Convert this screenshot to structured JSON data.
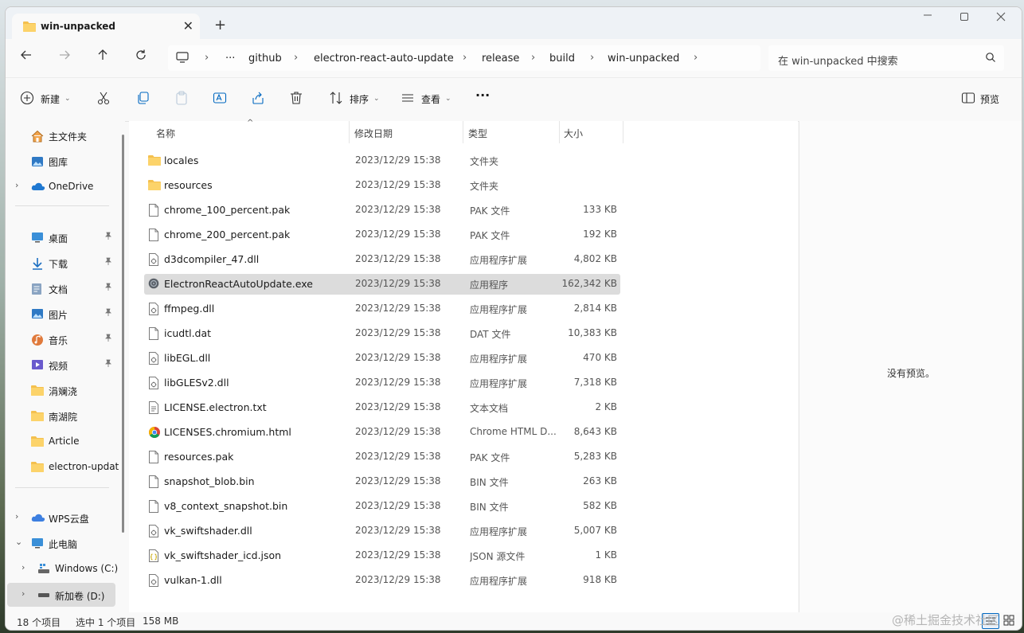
{
  "window": {
    "tab_title": "win-unpacked",
    "tab_close": "✕",
    "new_tab": "+"
  },
  "nav": {
    "breadcrumbs": [
      "github",
      "electron-react-auto-update",
      "release",
      "build",
      "win-unpacked"
    ],
    "more": "···",
    "search_placeholder": "在 win-unpacked 中搜索"
  },
  "toolbar": {
    "new_label": "新建",
    "sort_label": "排序",
    "view_label": "查看",
    "more_label": "···",
    "preview_label": "预览"
  },
  "sidebar": {
    "items": [
      {
        "label": "主文件夹",
        "icon": "home-icon",
        "pinned": false,
        "chevron": ""
      },
      {
        "label": "图库",
        "icon": "gallery-icon",
        "pinned": false,
        "chevron": ""
      },
      {
        "label": "OneDrive",
        "icon": "cloud-icon",
        "pinned": false,
        "chevron": "›"
      },
      {
        "label": "桌面",
        "icon": "desktop-icon",
        "pinned": true,
        "chevron": ""
      },
      {
        "label": "下载",
        "icon": "download-icon",
        "pinned": true,
        "chevron": ""
      },
      {
        "label": "文档",
        "icon": "document-icon",
        "pinned": true,
        "chevron": ""
      },
      {
        "label": "图片",
        "icon": "picture-icon",
        "pinned": true,
        "chevron": ""
      },
      {
        "label": "音乐",
        "icon": "music-icon",
        "pinned": true,
        "chevron": ""
      },
      {
        "label": "视频",
        "icon": "video-icon",
        "pinned": true,
        "chevron": ""
      },
      {
        "label": "涓斓浇",
        "icon": "folder-icon",
        "pinned": false,
        "chevron": ""
      },
      {
        "label": "南湖院",
        "icon": "folder-icon",
        "pinned": false,
        "chevron": ""
      },
      {
        "label": "Article",
        "icon": "folder-icon",
        "pinned": false,
        "chevron": ""
      },
      {
        "label": "electron-updat",
        "icon": "folder-icon",
        "pinned": false,
        "chevron": ""
      },
      {
        "label": "WPS云盘",
        "icon": "cloud-icon",
        "pinned": false,
        "chevron": "›"
      },
      {
        "label": "此电脑",
        "icon": "computer-icon",
        "pinned": false,
        "chevron": "⌄"
      },
      {
        "label": "Windows (C:)",
        "icon": "drive-icon",
        "pinned": false,
        "chevron": "›"
      },
      {
        "label": "新加卷 (D:)",
        "icon": "drive-icon",
        "pinned": false,
        "chevron": "›"
      }
    ],
    "pin_glyph": "📌"
  },
  "columns": {
    "name": "名称",
    "date": "修改日期",
    "type": "类型",
    "size": "大小"
  },
  "files": [
    {
      "name": "locales",
      "date": "2023/12/29 15:38",
      "type": "文件夹",
      "size": "",
      "icon": "folder-icon"
    },
    {
      "name": "resources",
      "date": "2023/12/29 15:38",
      "type": "文件夹",
      "size": "",
      "icon": "folder-icon"
    },
    {
      "name": "chrome_100_percent.pak",
      "date": "2023/12/29 15:38",
      "type": "PAK 文件",
      "size": "133 KB",
      "icon": "file-icon"
    },
    {
      "name": "chrome_200_percent.pak",
      "date": "2023/12/29 15:38",
      "type": "PAK 文件",
      "size": "192 KB",
      "icon": "file-icon"
    },
    {
      "name": "d3dcompiler_47.dll",
      "date": "2023/12/29 15:38",
      "type": "应用程序扩展",
      "size": "4,802 KB",
      "icon": "dll-icon"
    },
    {
      "name": "ElectronReactAutoUpdate.exe",
      "date": "2023/12/29 15:38",
      "type": "应用程序",
      "size": "162,342 KB",
      "icon": "app-icon"
    },
    {
      "name": "ffmpeg.dll",
      "date": "2023/12/29 15:38",
      "type": "应用程序扩展",
      "size": "2,814 KB",
      "icon": "dll-icon"
    },
    {
      "name": "icudtl.dat",
      "date": "2023/12/29 15:38",
      "type": "DAT 文件",
      "size": "10,383 KB",
      "icon": "file-icon"
    },
    {
      "name": "libEGL.dll",
      "date": "2023/12/29 15:38",
      "type": "应用程序扩展",
      "size": "470 KB",
      "icon": "dll-icon"
    },
    {
      "name": "libGLESv2.dll",
      "date": "2023/12/29 15:38",
      "type": "应用程序扩展",
      "size": "7,318 KB",
      "icon": "dll-icon"
    },
    {
      "name": "LICENSE.electron.txt",
      "date": "2023/12/29 15:38",
      "type": "文本文档",
      "size": "2 KB",
      "icon": "text-file-icon"
    },
    {
      "name": "LICENSES.chromium.html",
      "date": "2023/12/29 15:38",
      "type": "Chrome HTML D...",
      "size": "8,643 KB",
      "icon": "chrome-icon"
    },
    {
      "name": "resources.pak",
      "date": "2023/12/29 15:38",
      "type": "PAK 文件",
      "size": "5,283 KB",
      "icon": "file-icon"
    },
    {
      "name": "snapshot_blob.bin",
      "date": "2023/12/29 15:38",
      "type": "BIN 文件",
      "size": "263 KB",
      "icon": "file-icon"
    },
    {
      "name": "v8_context_snapshot.bin",
      "date": "2023/12/29 15:38",
      "type": "BIN 文件",
      "size": "582 KB",
      "icon": "file-icon"
    },
    {
      "name": "vk_swiftshader.dll",
      "date": "2023/12/29 15:38",
      "type": "应用程序扩展",
      "size": "5,007 KB",
      "icon": "dll-icon"
    },
    {
      "name": "vk_swiftshader_icd.json",
      "date": "2023/12/29 15:38",
      "type": "JSON 源文件",
      "size": "1 KB",
      "icon": "json-icon"
    },
    {
      "name": "vulkan-1.dll",
      "date": "2023/12/29 15:38",
      "type": "应用程序扩展",
      "size": "918 KB",
      "icon": "dll-icon"
    }
  ],
  "selected_file": "ElectronReactAutoUpdate.exe",
  "preview": {
    "message": "没有预览。"
  },
  "status": {
    "count": "18 个项目",
    "selection": "选中 1 个项目",
    "size": "158 MB"
  },
  "watermark": "@稀土掘金技术社区",
  "colors": {
    "folder": "#f4c04e",
    "accent": "#0067c0",
    "selected_row": "#dcdcdc"
  }
}
